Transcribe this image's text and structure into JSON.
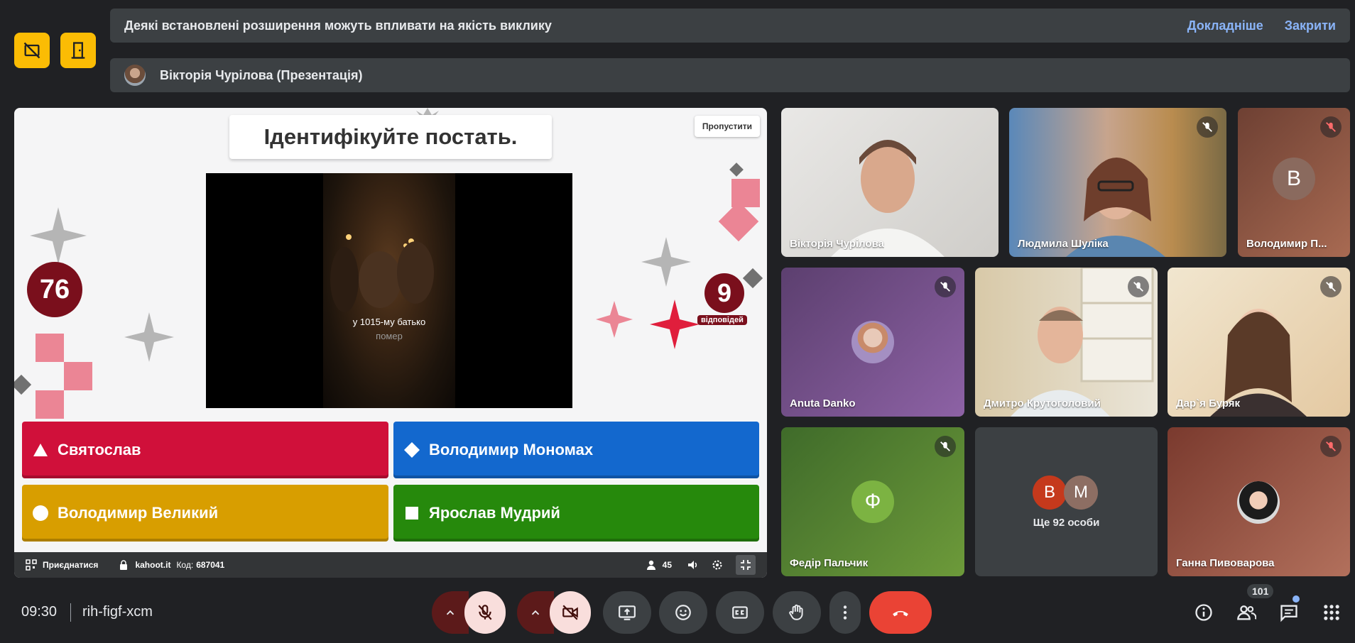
{
  "banners": {
    "extensions_msg": "Деякі встановлені розширення можуть впливати на якість виклику",
    "learn_more": "Докладніше",
    "close": "Закрити",
    "presenting": "Вікторія Чурілова (Презентація)"
  },
  "quiz": {
    "question_title": "Ідентифікуйте постать.",
    "skip": "Пропустити",
    "caption_line1": "у 1015-му батько",
    "caption_line2": "помер",
    "timer": "76",
    "answers_count": "9",
    "answers_label": "відповідей",
    "answers": [
      {
        "label": "Святослав",
        "shape": "triangle",
        "color": "#d0103a"
      },
      {
        "label": "Володимир Мономах",
        "shape": "diamond",
        "color": "#1368ce"
      },
      {
        "label": "Володимир Великий",
        "shape": "circle",
        "color": "#d89e00"
      },
      {
        "label": "Ярослав Мудрий",
        "shape": "square",
        "color": "#26890c"
      }
    ],
    "bar": {
      "join": "Приєднатися",
      "site": "kahoot.it",
      "code_label": "Код:",
      "code": "687041",
      "players": "45"
    }
  },
  "participants": [
    {
      "name": "Вікторія Чурілова"
    },
    {
      "name": "Людмила Шуліка"
    },
    {
      "name": "Володимир П...",
      "initial": "В"
    },
    {
      "name": "Anuta Danko"
    },
    {
      "name": "Дмитро Крутоголовий"
    },
    {
      "name": "Дар`я Буряк"
    },
    {
      "name": "Федір Пальчик",
      "initial": "Ф"
    },
    {
      "name": "Ще 92 особи",
      "initials": [
        "В",
        "М"
      ]
    },
    {
      "name": "Ганна Пивоварова"
    }
  ],
  "bottom": {
    "time": "09:30",
    "meeting_code": "rih-figf-xcm",
    "people_count": "101"
  },
  "colors": {
    "yellow": "#fbbc04",
    "end_call": "#ea4335",
    "muted_bg": "#f9dedc",
    "kahoot_red": "#7a0f1c"
  }
}
